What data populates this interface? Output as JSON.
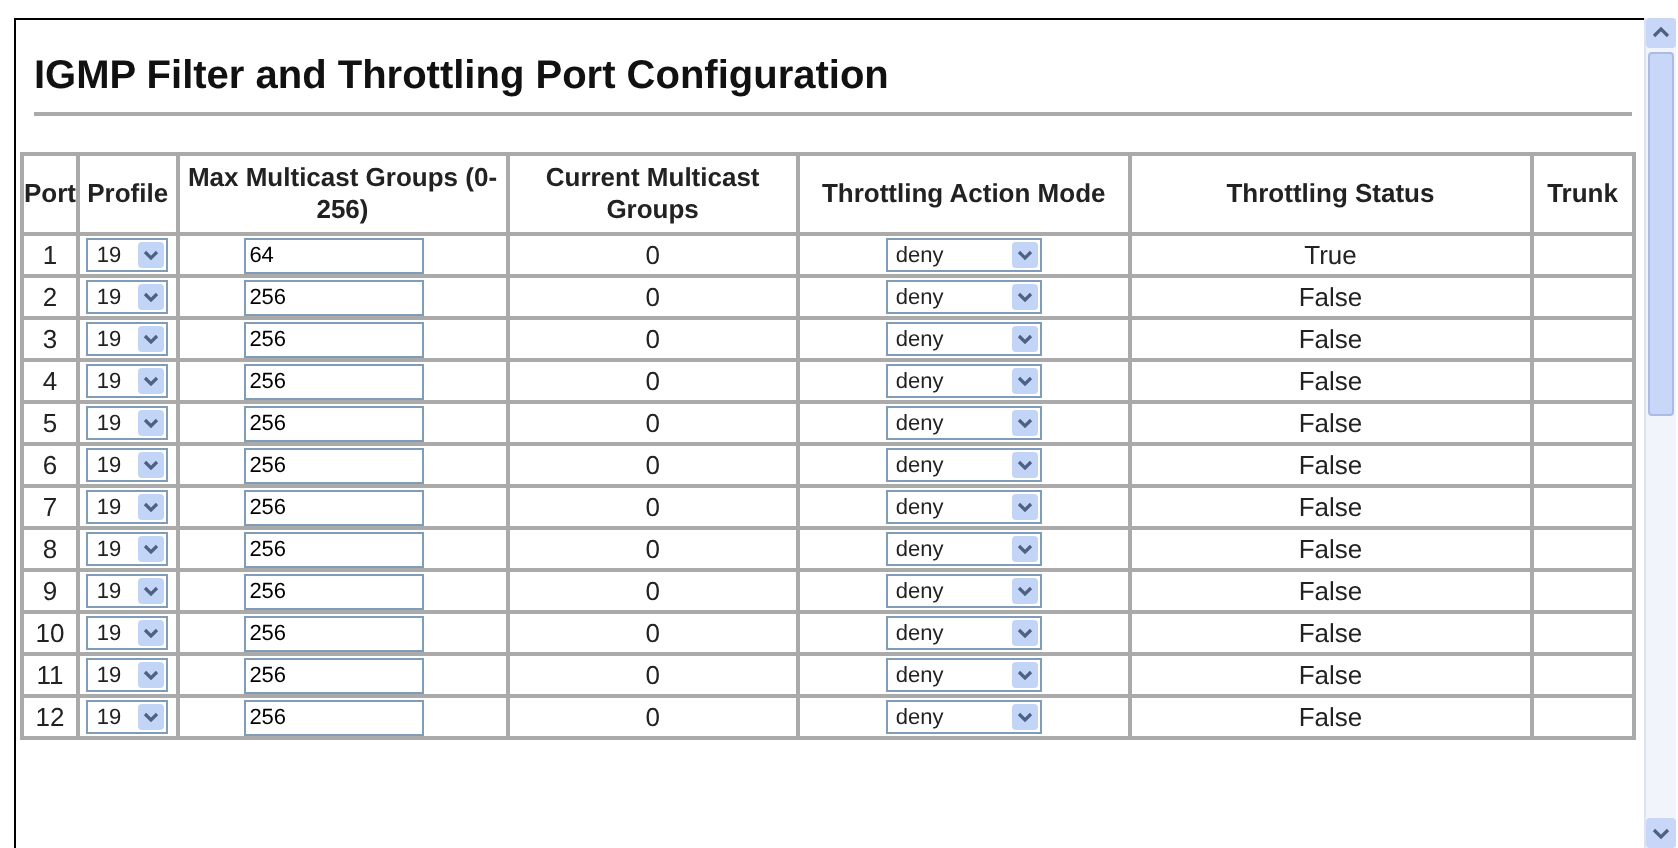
{
  "title": "IGMP Filter and Throttling Port Configuration",
  "table": {
    "columns": [
      "Port",
      "Profile",
      "Max Multicast Groups (0-256)",
      "Current Multicast Groups",
      "Throttling Action Mode",
      "Throttling Status",
      "Trunk"
    ],
    "rows": [
      {
        "port": "1",
        "profile": "19",
        "max_groups": "64",
        "current_groups": "0",
        "action_mode": "deny",
        "status": "True"
      },
      {
        "port": "2",
        "profile": "19",
        "max_groups": "256",
        "current_groups": "0",
        "action_mode": "deny",
        "status": "False"
      },
      {
        "port": "3",
        "profile": "19",
        "max_groups": "256",
        "current_groups": "0",
        "action_mode": "deny",
        "status": "False"
      },
      {
        "port": "4",
        "profile": "19",
        "max_groups": "256",
        "current_groups": "0",
        "action_mode": "deny",
        "status": "False"
      },
      {
        "port": "5",
        "profile": "19",
        "max_groups": "256",
        "current_groups": "0",
        "action_mode": "deny",
        "status": "False"
      },
      {
        "port": "6",
        "profile": "19",
        "max_groups": "256",
        "current_groups": "0",
        "action_mode": "deny",
        "status": "False"
      },
      {
        "port": "7",
        "profile": "19",
        "max_groups": "256",
        "current_groups": "0",
        "action_mode": "deny",
        "status": "False"
      },
      {
        "port": "8",
        "profile": "19",
        "max_groups": "256",
        "current_groups": "0",
        "action_mode": "deny",
        "status": "False"
      },
      {
        "port": "9",
        "profile": "19",
        "max_groups": "256",
        "current_groups": "0",
        "action_mode": "deny",
        "status": "False"
      },
      {
        "port": "10",
        "profile": "19",
        "max_groups": "256",
        "current_groups": "0",
        "action_mode": "deny",
        "status": "False"
      },
      {
        "port": "11",
        "profile": "19",
        "max_groups": "256",
        "current_groups": "0",
        "action_mode": "deny",
        "status": "False"
      },
      {
        "port": "12",
        "profile": "19",
        "max_groups": "256",
        "current_groups": "0",
        "action_mode": "deny",
        "status": "False"
      }
    ]
  }
}
